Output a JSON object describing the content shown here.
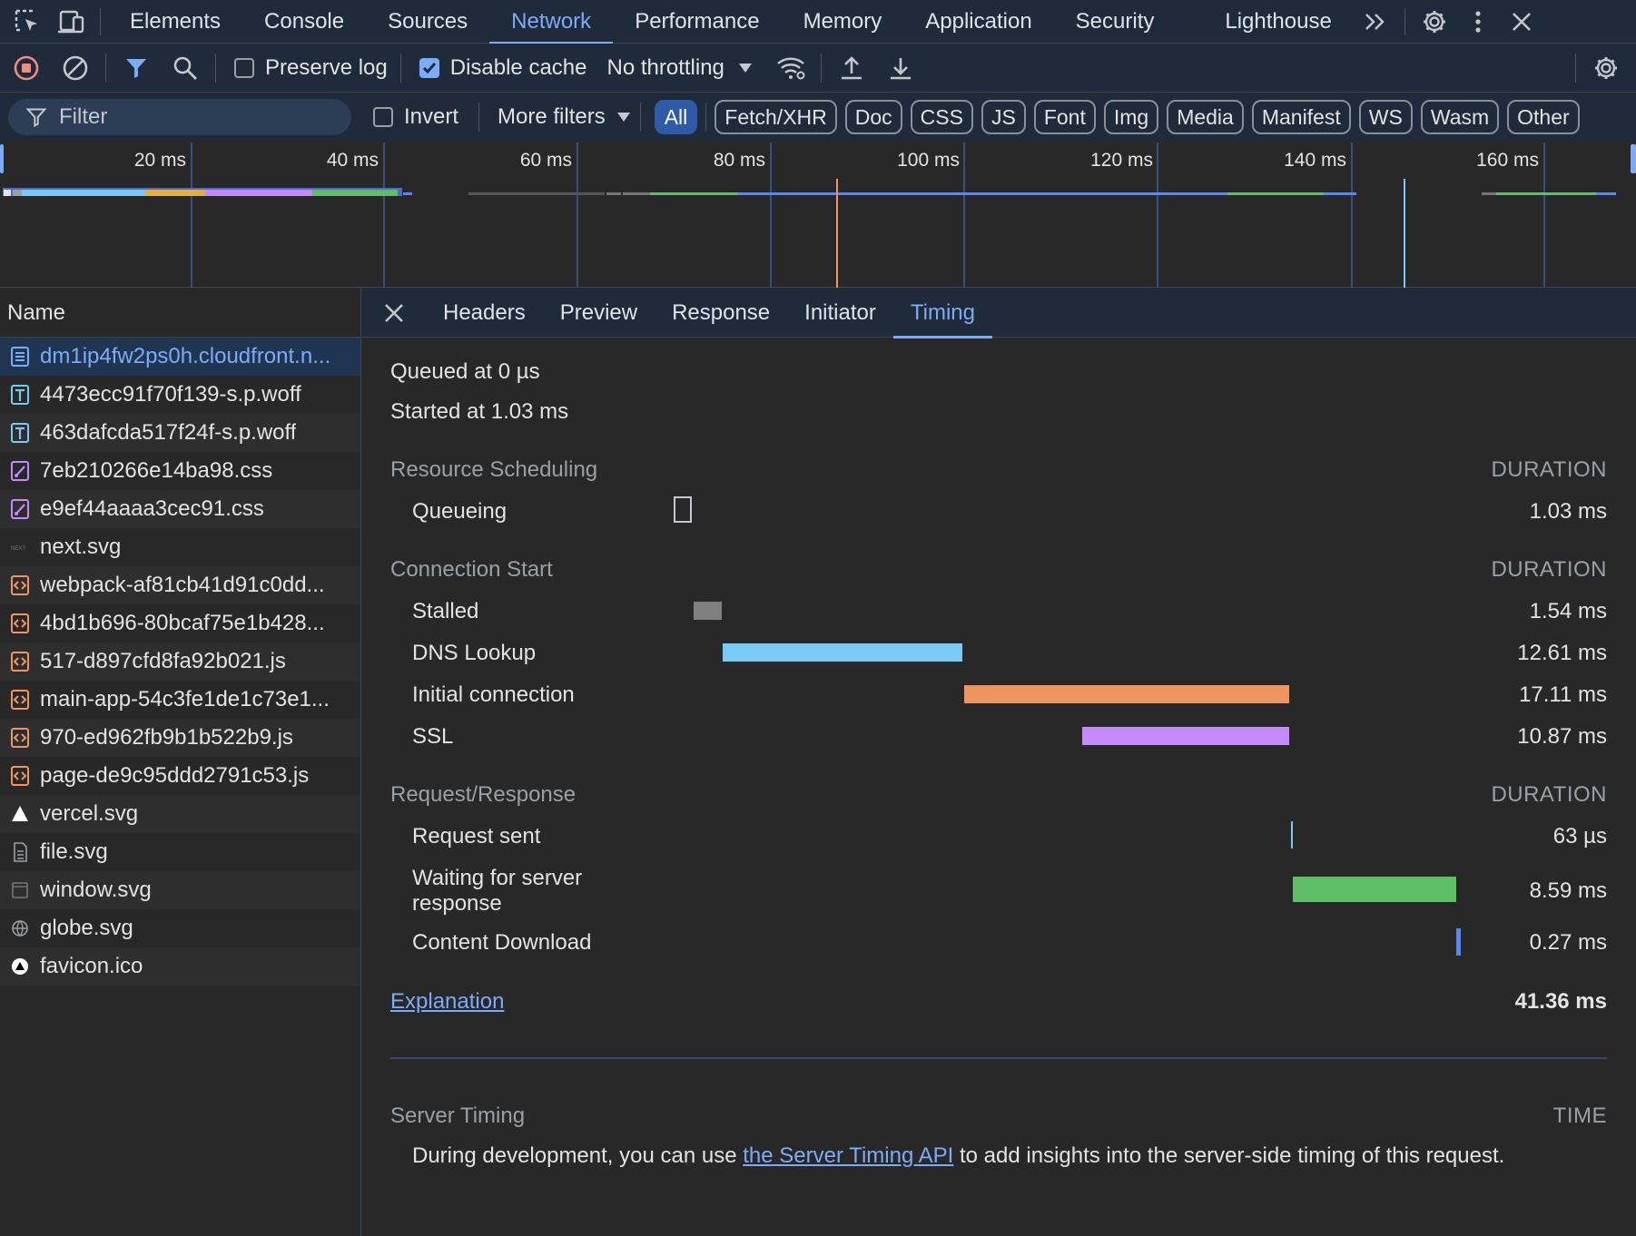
{
  "top_tabs": [
    "Elements",
    "Console",
    "Sources",
    "Network",
    "Performance",
    "Memory",
    "Application",
    "Security",
    "Lighthouse"
  ],
  "top_tabs_active": "Network",
  "toolbar": {
    "preserve_log": "Preserve log",
    "preserve_log_checked": false,
    "disable_cache": "Disable cache",
    "disable_cache_checked": true,
    "throttling": "No throttling"
  },
  "filterbar": {
    "filter_placeholder": "Filter",
    "invert": "Invert",
    "more_filters": "More filters",
    "chips": [
      "All",
      "Fetch/XHR",
      "Doc",
      "CSS",
      "JS",
      "Font",
      "Img",
      "Media",
      "Manifest",
      "WS",
      "Wasm",
      "Other"
    ],
    "active_chip": "All"
  },
  "overview": {
    "ticks": [
      "20 ms",
      "40 ms",
      "60 ms",
      "80 ms",
      "100 ms",
      "120 ms",
      "140 ms",
      "160 ms"
    ]
  },
  "namelist": {
    "header": "Name",
    "rows": [
      {
        "name": "dm1ip4fw2ps0h.cloudfront.n...",
        "type": "doc",
        "selected": true
      },
      {
        "name": "4473ecc91f70f139-s.p.woff",
        "type": "font"
      },
      {
        "name": "463dafcda517f24f-s.p.woff",
        "type": "font"
      },
      {
        "name": "7eb210266e14ba98.css",
        "type": "css"
      },
      {
        "name": "e9ef44aaaa3cec91.css",
        "type": "css"
      },
      {
        "name": "next.svg",
        "type": "next"
      },
      {
        "name": "webpack-af81cb41d91c0dd...",
        "type": "js"
      },
      {
        "name": "4bd1b696-80bcaf75e1b428...",
        "type": "js"
      },
      {
        "name": "517-d897cfd8fa92b021.js",
        "type": "js"
      },
      {
        "name": "main-app-54c3fe1de1c73e1...",
        "type": "js"
      },
      {
        "name": "970-ed962fb9b1b522b9.js",
        "type": "js"
      },
      {
        "name": "page-de9c95ddd2791c53.js",
        "type": "js"
      },
      {
        "name": "vercel.svg",
        "type": "vercel"
      },
      {
        "name": "file.svg",
        "type": "file"
      },
      {
        "name": "window.svg",
        "type": "window"
      },
      {
        "name": "globe.svg",
        "type": "globe"
      },
      {
        "name": "favicon.ico",
        "type": "favicon"
      }
    ]
  },
  "detail_tabs": [
    "Headers",
    "Preview",
    "Response",
    "Initiator",
    "Timing"
  ],
  "detail_tabs_active": "Timing",
  "timing": {
    "queued": "Queued at 0 µs",
    "started": "Started at 1.03 ms",
    "duration_label": "DURATION",
    "sections": [
      {
        "title": "Resource Scheduling",
        "rows": [
          {
            "label": "Queueing",
            "value": "1.03 ms"
          }
        ]
      },
      {
        "title": "Connection Start",
        "rows": [
          {
            "label": "Stalled",
            "value": "1.54 ms"
          },
          {
            "label": "DNS Lookup",
            "value": "12.61 ms"
          },
          {
            "label": "Initial connection",
            "value": "17.11 ms"
          },
          {
            "label": "SSL",
            "value": "10.87 ms"
          }
        ]
      },
      {
        "title": "Request/Response",
        "rows": [
          {
            "label": "Request sent",
            "value": "63 µs"
          },
          {
            "label": "Waiting for server",
            "label2": "response",
            "value": "8.59 ms"
          },
          {
            "label": "Content Download",
            "value": "0.27 ms"
          }
        ]
      }
    ],
    "explanation": "Explanation",
    "total": "41.36 ms",
    "server_timing": {
      "title": "Server Timing",
      "time_label": "TIME",
      "text_before": "During development, you can use ",
      "link": "the Server Timing API",
      "text_after": " to add insights into the server-side timing of this request."
    }
  },
  "colors": {
    "accent": "#7cacf8",
    "stalled": "#808080",
    "dns": "#79cbf5",
    "initial_connection": "#f0955f",
    "ssl": "#c58af9",
    "waiting": "#5fbf68",
    "download": "#5a86f5"
  }
}
